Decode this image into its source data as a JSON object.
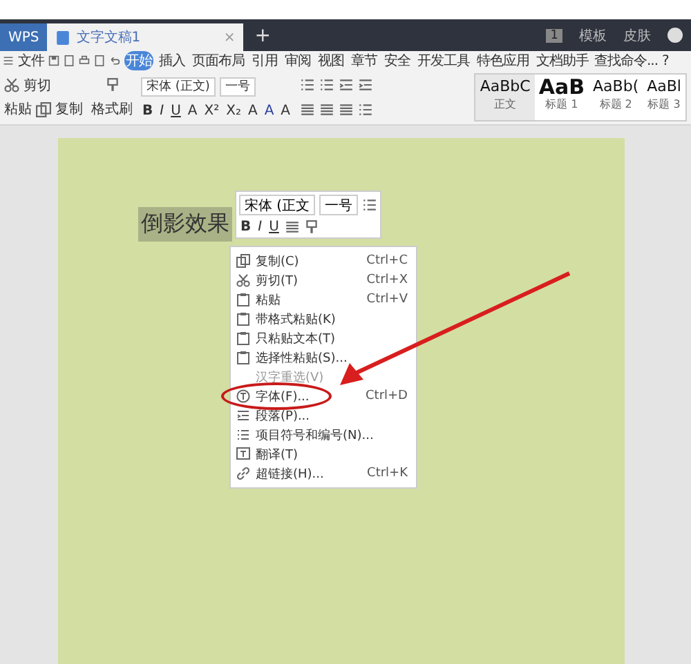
{
  "title_bar": {
    "tabs": [
      {
        "label": "WPS",
        "kind": "app",
        "selected": false
      },
      {
        "label": "文字文稿1",
        "kind": "doc",
        "selected": true,
        "close": "×"
      }
    ],
    "new_tab": "+",
    "right": [
      {
        "label": "1",
        "kind": "badge"
      },
      {
        "label": "模板",
        "kind": "link"
      },
      {
        "label": "皮肤",
        "kind": "link"
      },
      {
        "kind": "avatar"
      }
    ]
  },
  "menu_bar": {
    "file": "文件",
    "tabs": [
      {
        "label": "开始",
        "selected": true
      },
      {
        "label": "插入",
        "selected": false
      },
      {
        "label": "页面布局",
        "selected": false
      },
      {
        "label": "引用",
        "selected": false
      },
      {
        "label": "审阅",
        "selected": false
      },
      {
        "label": "视图",
        "selected": false
      },
      {
        "label": "章节",
        "selected": false
      },
      {
        "label": "安全",
        "selected": false
      },
      {
        "label": "开发工具",
        "selected": false
      },
      {
        "label": "特色应用",
        "selected": false
      },
      {
        "label": "文档助手",
        "selected": false
      }
    ],
    "search": "查找命令...",
    "help": "?"
  },
  "ribbon": {
    "clipboard": {
      "paste": "粘贴",
      "cut": "剪切",
      "copy": "复制",
      "format_painter": "格式刷"
    },
    "font": {
      "name": "宋体 (正文)",
      "size": "一号",
      "format_buttons": [
        "B",
        "I",
        "U",
        "A",
        "X²",
        "X₂",
        "A",
        "A",
        "A"
      ]
    },
    "styles": [
      {
        "sample": "AaBbC",
        "label": "正文",
        "selected": true
      },
      {
        "sample": "AaB",
        "label": "标题 1",
        "selected": false
      },
      {
        "sample": "AaBb(",
        "label": "标题 2",
        "selected": false
      },
      {
        "sample": "AaBl",
        "label": "标题 3",
        "selected": false
      }
    ]
  },
  "document": {
    "text": "倒影效果",
    "selected": true
  },
  "mini_toolbar": {
    "font": "宋体 (正文",
    "size": "一号",
    "buttons": [
      "B",
      "I",
      "U"
    ]
  },
  "context_menu": {
    "items": [
      {
        "label": "复制(C)",
        "shortcut": "Ctrl+C",
        "disabled": false
      },
      {
        "label": "剪切(T)",
        "shortcut": "Ctrl+X",
        "disabled": false
      },
      {
        "label": "粘贴",
        "shortcut": "Ctrl+V",
        "disabled": false
      },
      {
        "label": "带格式粘贴(K)",
        "disabled": false
      },
      {
        "label": "只粘贴文本(T)",
        "disabled": false
      },
      {
        "label": "选择性粘贴(S)...",
        "disabled": false
      },
      {
        "label": "汉字重选(V)",
        "disabled": true
      },
      {
        "label": "字体(F)...",
        "shortcut": "Ctrl+D",
        "disabled": false,
        "circled": true
      },
      {
        "label": "段落(P)...",
        "disabled": false
      },
      {
        "label": "项目符号和编号(N)...",
        "disabled": false
      },
      {
        "label": "翻译(T)",
        "disabled": false
      },
      {
        "label": "超链接(H)...",
        "shortcut": "Ctrl+K",
        "disabled": false
      }
    ]
  },
  "annotation": {
    "kind": "arrow"
  }
}
